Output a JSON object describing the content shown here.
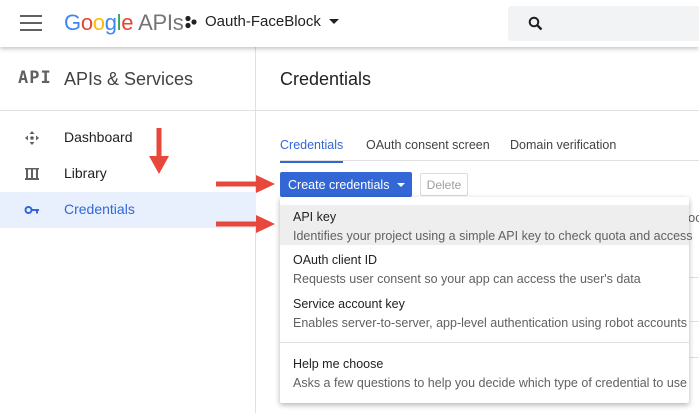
{
  "colors": {
    "accent": "#3367d6",
    "arrow": "#e8473b",
    "active_bg": "#e8f0fe"
  },
  "header": {
    "logo_letters": [
      "G",
      "o",
      "o",
      "g",
      "l",
      "e"
    ],
    "logo_suffix": "APIs",
    "project_name": "Oauth-FaceBlock",
    "icons": {
      "menu": "hamburger-icon",
      "project": "project-icon",
      "search": "search-icon"
    }
  },
  "sidebar": {
    "badge": "API",
    "title": "APIs & Services",
    "items": [
      {
        "label": "Dashboard",
        "icon": "dashboard-icon",
        "active": false
      },
      {
        "label": "Library",
        "icon": "library-icon",
        "active": false
      },
      {
        "label": "Credentials",
        "icon": "key-icon",
        "active": true
      }
    ]
  },
  "main": {
    "title": "Credentials",
    "tabs": [
      {
        "label": "Credentials",
        "active": true
      },
      {
        "label": "OAuth consent screen",
        "active": false
      },
      {
        "label": "Domain verification",
        "active": false
      }
    ],
    "create_button": "Create credentials",
    "delete_button": "Delete",
    "background_text": "oc"
  },
  "menu": {
    "options": [
      {
        "title": "API key",
        "desc": "Identifies your project using a simple API key to check quota and access"
      },
      {
        "title": "OAuth client ID",
        "desc": "Requests user consent so your app can access the user's data"
      },
      {
        "title": "Service account key",
        "desc": "Enables server-to-server, app-level authentication using robot accounts"
      },
      {
        "title": "Help me choose",
        "desc": "Asks a few questions to help you decide which type of credential to use"
      }
    ]
  }
}
